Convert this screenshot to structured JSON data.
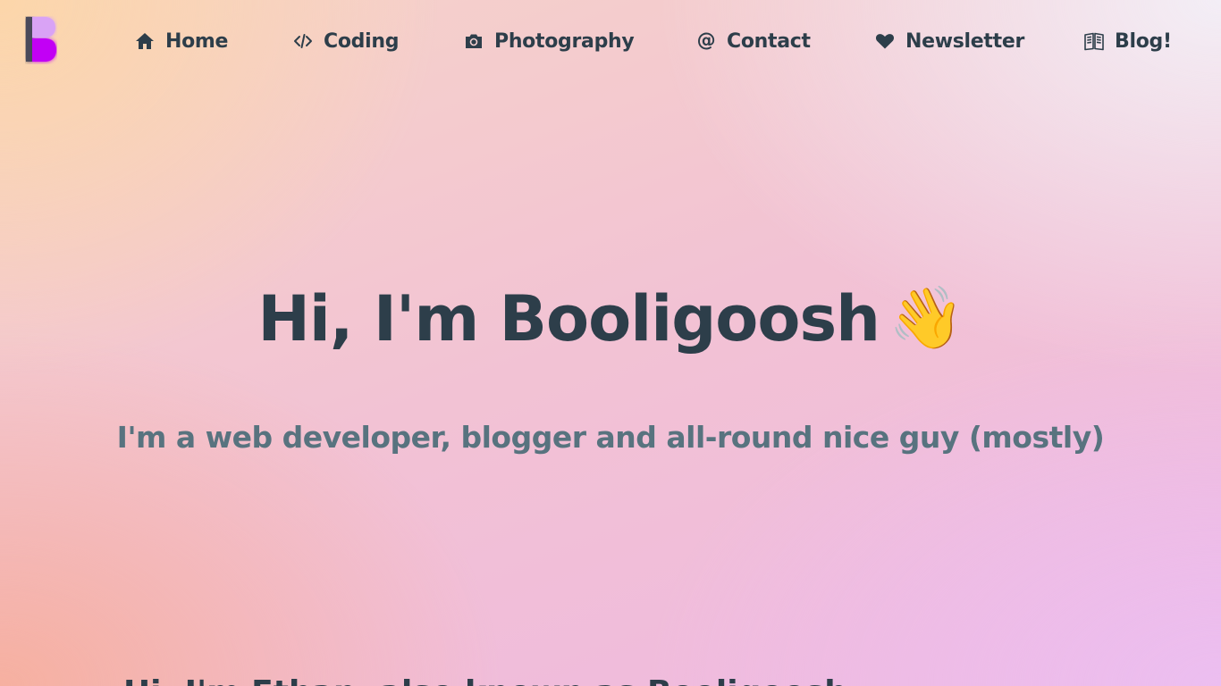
{
  "nav": {
    "items": [
      {
        "label": "Home",
        "icon": "home-icon"
      },
      {
        "label": "Coding",
        "icon": "code-icon"
      },
      {
        "label": "Photography",
        "icon": "camera-icon"
      },
      {
        "label": "Contact",
        "icon": "at-icon"
      },
      {
        "label": "Newsletter",
        "icon": "heart-icon"
      },
      {
        "label": "Blog!",
        "icon": "book-icon"
      }
    ]
  },
  "hero": {
    "title": "Hi, I'm Booligoosh",
    "wave": "👋",
    "subtitle": "I'm a web developer, blogger and all-round nice guy (mostly)"
  },
  "next_section": {
    "heading": "Hi, I'm Ethan, also known as Booligoosh"
  },
  "colors": {
    "text": "#2d3e4a",
    "subtitle": "#58737f",
    "logo_light": "#d9a3f5",
    "logo_dark": "#c200f5"
  }
}
